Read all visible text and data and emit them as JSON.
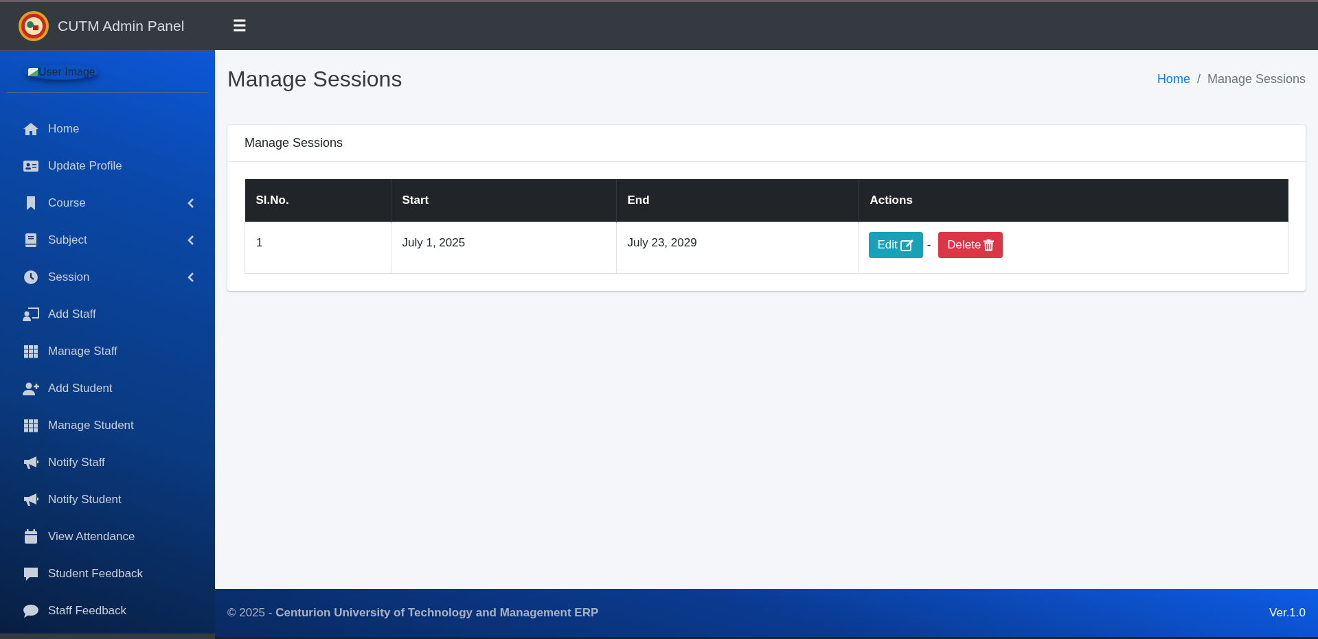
{
  "brand": {
    "title": "CUTM Admin Panel"
  },
  "topbar": {
    "menu_toggle": "☰"
  },
  "user_panel": {
    "image_alt": "User Image"
  },
  "sidebar": {
    "items": [
      {
        "label": "Home",
        "expandable": false
      },
      {
        "label": "Update Profile",
        "expandable": false
      },
      {
        "label": "Course",
        "expandable": true
      },
      {
        "label": "Subject",
        "expandable": true
      },
      {
        "label": "Session",
        "expandable": true
      },
      {
        "label": "Add Staff",
        "expandable": false
      },
      {
        "label": "Manage Staff",
        "expandable": false
      },
      {
        "label": "Add Student",
        "expandable": false
      },
      {
        "label": "Manage Student",
        "expandable": false
      },
      {
        "label": "Notify Staff",
        "expandable": false
      },
      {
        "label": "Notify Student",
        "expandable": false
      },
      {
        "label": "View Attendance",
        "expandable": false
      },
      {
        "label": "Student Feedback",
        "expandable": false
      },
      {
        "label": "Staff Feedback",
        "expandable": false
      }
    ]
  },
  "page": {
    "title": "Manage Sessions",
    "breadcrumb_separator": "/",
    "breadcrumb": [
      {
        "label": "Home",
        "link": true
      },
      {
        "label": "Manage Sessions",
        "link": false
      }
    ]
  },
  "card": {
    "title": "Manage Sessions",
    "table": {
      "columns": [
        "Sl.No.",
        "Start",
        "End",
        "Actions"
      ],
      "rows": [
        {
          "cells": [
            "1",
            "July 1, 2025",
            "July 23, 2029"
          ],
          "actions": [
            {
              "label": "Edit",
              "kind": "edit"
            },
            {
              "label": "Delete",
              "kind": "delete"
            }
          ],
          "separator": "-"
        }
      ]
    }
  },
  "footer": {
    "text": "© 2025 - **Centurion University of Technology and Management** **ERP**",
    "version": "Ver.1.0"
  }
}
